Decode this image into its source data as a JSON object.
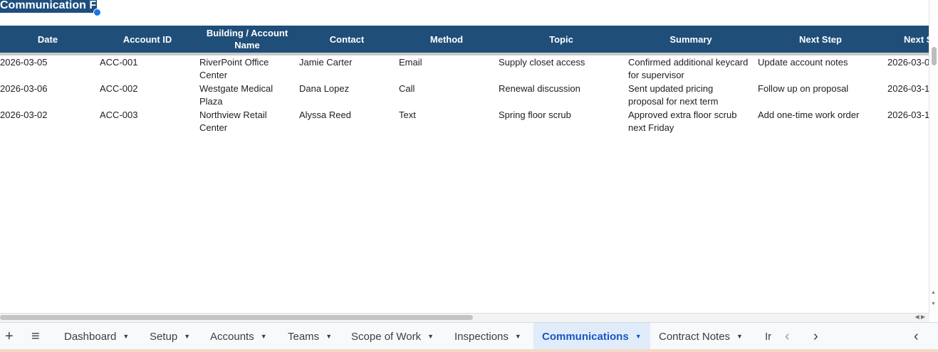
{
  "sheet_title": "Communication F",
  "columns": [
    "Date",
    "Account ID",
    "Building / Account Name",
    "Contact",
    "Method",
    "Topic",
    "Summary",
    "Next Step",
    "Next S"
  ],
  "rows": [
    {
      "date": "2026-03-05",
      "account_id": "ACC-001",
      "building": "RiverPoint Office Center",
      "contact": "Jamie Carter",
      "method": "Email",
      "topic": "Supply closet access",
      "summary": "Confirmed additional keycard for supervisor",
      "next_step": "Update account notes",
      "next_date": "2026-03-0"
    },
    {
      "date": "2026-03-06",
      "account_id": "ACC-002",
      "building": "Westgate Medical Plaza",
      "contact": "Dana Lopez",
      "method": "Call",
      "topic": "Renewal discussion",
      "summary": "Sent updated pricing proposal for next term",
      "next_step": "Follow up on proposal",
      "next_date": "2026-03-1"
    },
    {
      "date": "2026-03-02",
      "account_id": "ACC-003",
      "building": "Northview Retail Center",
      "contact": "Alyssa Reed",
      "method": "Text",
      "topic": "Spring floor scrub",
      "summary": "Approved extra floor scrub next Friday",
      "next_step": "Add one-time work order",
      "next_date": "2026-03-1"
    }
  ],
  "tabs": [
    {
      "label": "Dashboard",
      "active": false
    },
    {
      "label": "Setup",
      "active": false
    },
    {
      "label": "Accounts",
      "active": false
    },
    {
      "label": "Teams",
      "active": false
    },
    {
      "label": "Scope of Work",
      "active": false
    },
    {
      "label": "Inspections",
      "active": false
    },
    {
      "label": "Communications",
      "active": true
    },
    {
      "label": "Contract Notes",
      "active": false
    },
    {
      "label": "Ir",
      "active": false
    }
  ],
  "icons": {
    "add": "+",
    "menu": "≡",
    "prev": "‹",
    "next": "›",
    "collapse": "‹",
    "caret": "▼"
  },
  "colors": {
    "header_bg": "#1f4e79",
    "active_tab_bg": "#e1ecfa",
    "active_tab_text": "#1a56c4"
  }
}
